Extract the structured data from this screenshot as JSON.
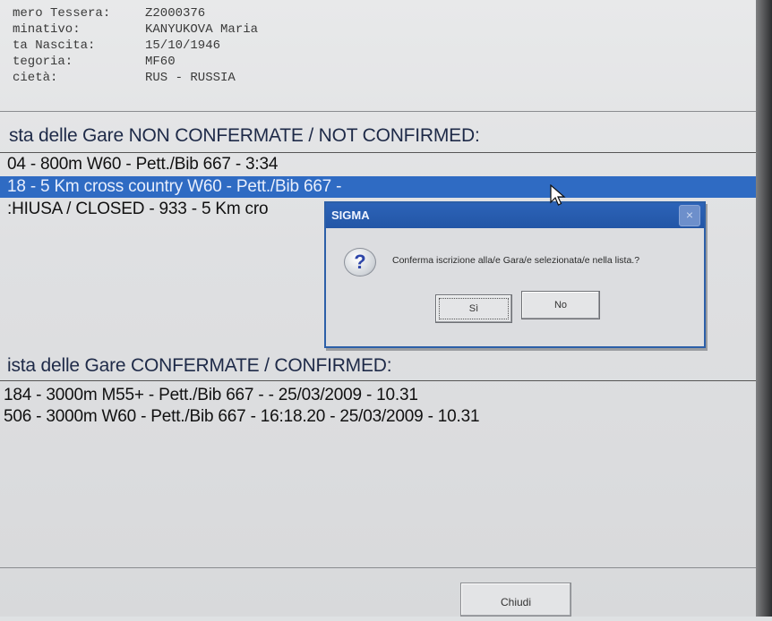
{
  "athlete": {
    "rows": [
      {
        "label": "mero Tessera:",
        "value": "Z2000376"
      },
      {
        "label": "minativo:",
        "value": "KANYUKOVA Maria"
      },
      {
        "label": "ta Nascita:",
        "value": "15/10/1946"
      },
      {
        "label": "tegoria:",
        "value": "MF60"
      },
      {
        "label": "cietà:",
        "value": "RUS - RUSSIA"
      }
    ]
  },
  "not_confirmed": {
    "title": "sta delle Gare NON CONFERMATE / NOT CONFIRMED:",
    "items": [
      "04 - 800m W60 - Pett./Bib 667 - 3:34",
      "18 - 5 Km cross country W60 - Pett./Bib 667 -",
      ":HIUSA / CLOSED - 933 - 5 Km cro"
    ],
    "selected_index": 1
  },
  "confirmed": {
    "title": "ista delle Gare CONFERMATE / CONFIRMED:",
    "items": [
      "184 - 3000m M55+ - Pett./Bib 667 -  - 25/03/2009 - 10.31",
      "506 - 3000m W60 - Pett./Bib 667 - 16:18.20 - 25/03/2009 - 10.31"
    ]
  },
  "dialog": {
    "title": "SIGMA",
    "icon": "question-icon",
    "message": "Conferma iscrizione alla/e Gara/e selezionata/e nella lista.?",
    "yes_label": "Sì",
    "no_label": "No",
    "close_glyph": "×"
  },
  "footer": {
    "close_label": "Chiudi"
  },
  "colors": {
    "selection": "#2f6bc3",
    "titlebar": "#2356a6",
    "background": "#dfe1e3"
  }
}
